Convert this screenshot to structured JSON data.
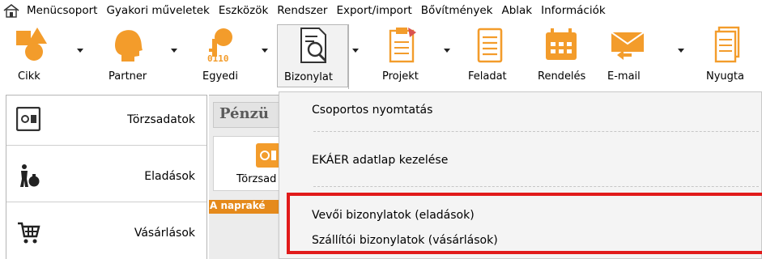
{
  "menubar": {
    "home_icon": "home-icon",
    "items": [
      "Menücsoport",
      "Gyakori műveletek",
      "Eszközök",
      "Rendszer",
      "Export/import",
      "Bővítmények",
      "Ablak",
      "Információk"
    ]
  },
  "toolbar": {
    "buttons": [
      {
        "label": "Cikk",
        "icon": "shapes-icon",
        "has_dropdown": true
      },
      {
        "label": "Partner",
        "icon": "person-head-icon",
        "has_dropdown": true
      },
      {
        "label": "Egyedi",
        "icon": "key-icon",
        "has_dropdown": true
      },
      {
        "label": "Bizonylat",
        "icon": "document-search-icon",
        "has_dropdown": true,
        "active": true
      },
      {
        "label": "Projekt",
        "icon": "clipboard-icon",
        "has_dropdown": true
      },
      {
        "label": "Feladat",
        "icon": "notepad-icon",
        "has_dropdown": false
      },
      {
        "label": "Rendelés",
        "icon": "calendar-icon",
        "has_dropdown": false
      },
      {
        "label": "E-mail",
        "icon": "envelope-icon",
        "has_dropdown": true
      },
      {
        "label": "Nyugta",
        "icon": "receipt-icon",
        "has_dropdown": false
      }
    ]
  },
  "leftnav": {
    "items": [
      {
        "label": "Törzsadatok",
        "icon": "safe-icon"
      },
      {
        "label": "Eladások",
        "icon": "person-money-bag-icon"
      },
      {
        "label": "Vásárlások",
        "icon": "shopping-cart-icon"
      }
    ]
  },
  "panel": {
    "header": "Pénzü",
    "tile_label": "Törzsad",
    "tile_icon": "safe-icon",
    "status_bar": "A napraké"
  },
  "dropdown": {
    "items": [
      "Csoportos nyomtatás",
      "EKÁER adatlap kezelése",
      "Vevői bizonylatok (eladások)",
      "Szállítói bizonylatok (vásárlások)"
    ]
  },
  "colors": {
    "accent_orange": "#f39c2b",
    "highlight_red": "#e11b1b",
    "panel_orange_bar": "#e58a1c"
  }
}
